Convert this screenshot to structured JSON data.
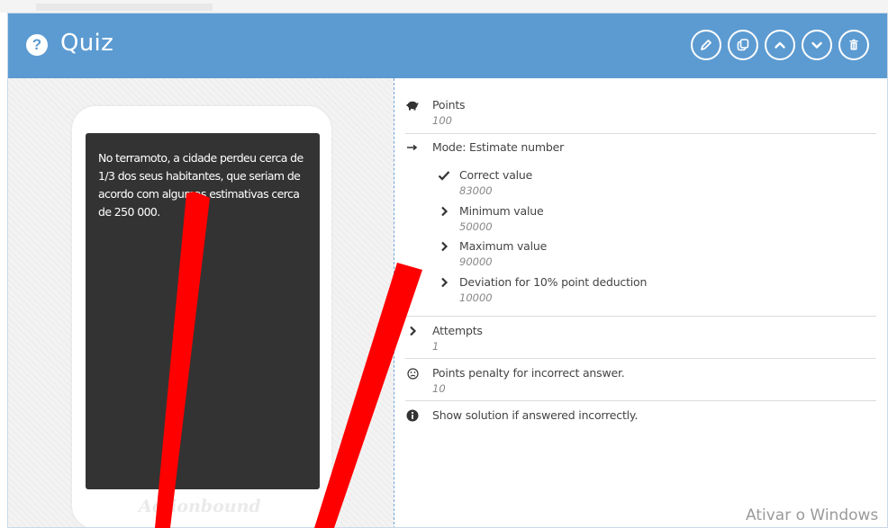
{
  "header": {
    "title": "Quiz",
    "buttons": [
      "edit-icon",
      "copy-icon",
      "chevron-up-icon",
      "chevron-down-icon",
      "trash-icon"
    ]
  },
  "preview": {
    "question_text": "No terramoto, a cidade perdeu cerca de 1/3 dos seus habitantes, que seriam de acordo com algumas estimativas cerca de 250 000.",
    "brand": "Actionbound"
  },
  "properties": {
    "points": {
      "label": "Points",
      "value": "100"
    },
    "mode": {
      "label": "Mode: Estimate number"
    },
    "correct": {
      "label": "Correct value",
      "value": "83000"
    },
    "minimum": {
      "label": "Minimum value",
      "value": "50000"
    },
    "maximum": {
      "label": "Maximum value",
      "value": "90000"
    },
    "deviation": {
      "label": "Deviation for 10% point deduction",
      "value": "10000"
    },
    "attempts": {
      "label": "Attempts",
      "value": "1"
    },
    "penalty": {
      "label": "Points penalty for incorrect answer.",
      "value": "10"
    },
    "solution": {
      "label": "Show solution if answered incorrectly."
    }
  },
  "watermark": "Ativar o Windows",
  "colors": {
    "header": "#5c9bd1",
    "screen": "#333333",
    "annotation": "#ff0000"
  }
}
